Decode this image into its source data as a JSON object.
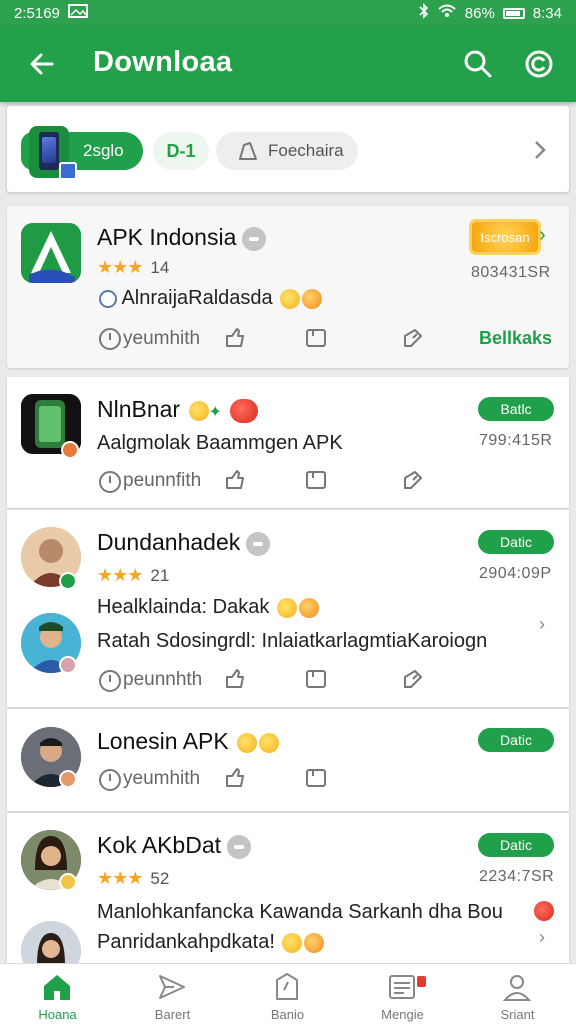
{
  "status_bar": {
    "time": "2:5169",
    "battery": "86%",
    "right_time": "8:34"
  },
  "app_bar": {
    "title": "Downloaa"
  },
  "filters": {
    "apps_chip": "2sglo",
    "count_chip": "D-1",
    "fav_chip": "Foechaira"
  },
  "items": [
    {
      "name": "APK Indonsia",
      "rating": "14",
      "desc": "AlnraijaRaldasda",
      "size": "803431SR",
      "badge": "Iscrosan",
      "action1": "yeumhith",
      "link": "Bellkaks"
    },
    {
      "name": "NlnBnar",
      "desc": "Aalgmolak Baammgen APK",
      "size": "799:415R",
      "get": "Batlc",
      "action1": "peunnfith"
    },
    {
      "name": "Dundanhadek",
      "rating": "21",
      "desc": "Healklainda: Dakak",
      "desc2": "Ratah Sdosingrdl: InlaiatkarlagmtiaKaroiogn",
      "size": "2904:09P",
      "get": "Datic",
      "action1": "peunnhth"
    },
    {
      "name": "Lonesin APK",
      "get": "Datic",
      "action1": "yeumhith"
    },
    {
      "name": "Kok AKbDat",
      "rating": "52",
      "desc": "Manlohkanfancka Kawanda Sarkanh dha Bou",
      "desc2": "Panridankahpdkata!",
      "size": "2234:7SR",
      "get": "Datic"
    }
  ],
  "bottom_nav": [
    {
      "label": "Hoana"
    },
    {
      "label": "Barert"
    },
    {
      "label": "Banio"
    },
    {
      "label": "Mengie"
    },
    {
      "label": "Sriant"
    }
  ],
  "colors": {
    "primary": "#23a04a",
    "status": "#2ea14e",
    "star": "#f5a623"
  }
}
